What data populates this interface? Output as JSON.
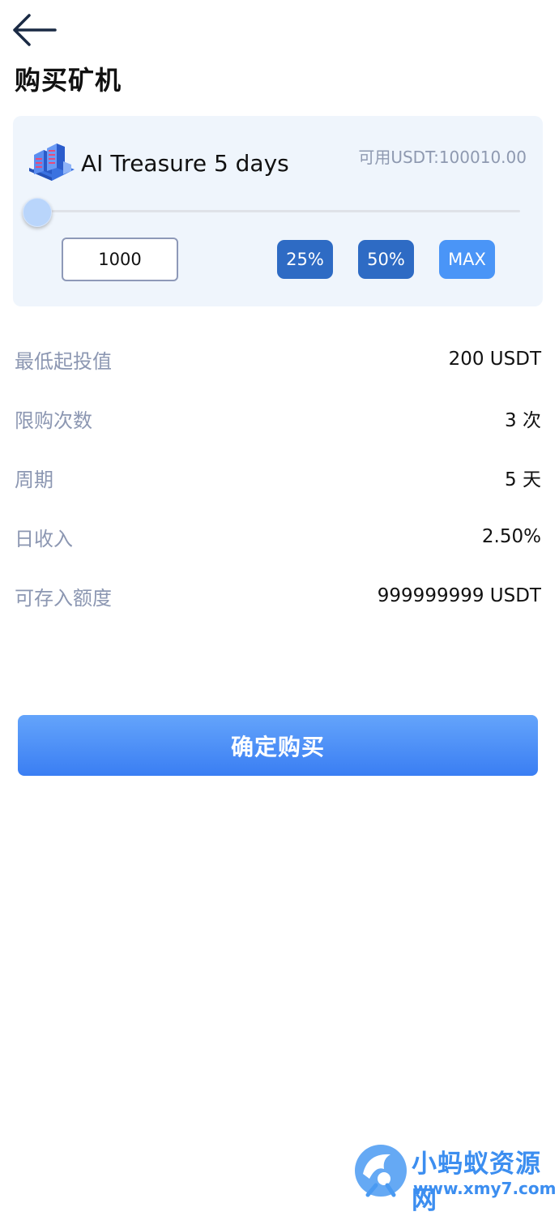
{
  "header": {
    "title": "购买矿机",
    "back_icon": "arrow-left-icon"
  },
  "product": {
    "name": "AI Treasure 5 days",
    "icon": "server-rack-icon",
    "balance_text": "可用USDT:100010.00"
  },
  "slider": {
    "value_fraction": 0.0
  },
  "amount": {
    "value": "1000"
  },
  "quick_buttons": {
    "pct25": "25%",
    "pct50": "50%",
    "max": "MAX"
  },
  "details": [
    {
      "label": "最低起投值",
      "value": "200 USDT"
    },
    {
      "label": "限购次数",
      "value": "3 次"
    },
    {
      "label": "周期",
      "value": "5 天"
    },
    {
      "label": "日收入",
      "value": "2.50%"
    },
    {
      "label": "可存入额度",
      "value": "999999999 USDT"
    }
  ],
  "confirm": {
    "label": "确定购买"
  },
  "watermark": {
    "title": "小蚂蚁资源网",
    "url": "www.xmy7.com"
  },
  "colors": {
    "accent": "#3a7ef3",
    "button_dark": "#2e6bc4",
    "button_light": "#4a95f7",
    "card_bg": "#eff5fc",
    "label_gray": "#8c97b2"
  }
}
